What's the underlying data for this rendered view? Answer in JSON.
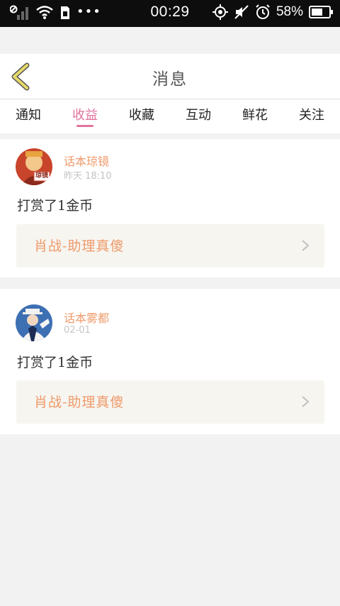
{
  "status_bar": {
    "time": "00:29",
    "battery": "58%",
    "overflow_dots": "•••"
  },
  "header": {
    "title": "消息"
  },
  "tabs": [
    {
      "label": "通知",
      "active": false
    },
    {
      "label": "收益",
      "active": true
    },
    {
      "label": "收藏",
      "active": false
    },
    {
      "label": "互动",
      "active": false
    },
    {
      "label": "鲜花",
      "active": false
    },
    {
      "label": "关注",
      "active": false
    }
  ],
  "messages": [
    {
      "user": "话本琼镜",
      "time": "昨天 18:10",
      "text": "打赏了1金币",
      "link": "肖战-助理真傻",
      "avatar_badge": "琼镜"
    },
    {
      "user": "话本雾都",
      "time": "02-01",
      "text": "打赏了1金币",
      "link": "肖战-助理真傻"
    }
  ],
  "colors": {
    "accent": "#e1739e",
    "username": "#ef9a6a",
    "link_bg": "#f6f5f0",
    "back_icon": "#e6d96a"
  }
}
